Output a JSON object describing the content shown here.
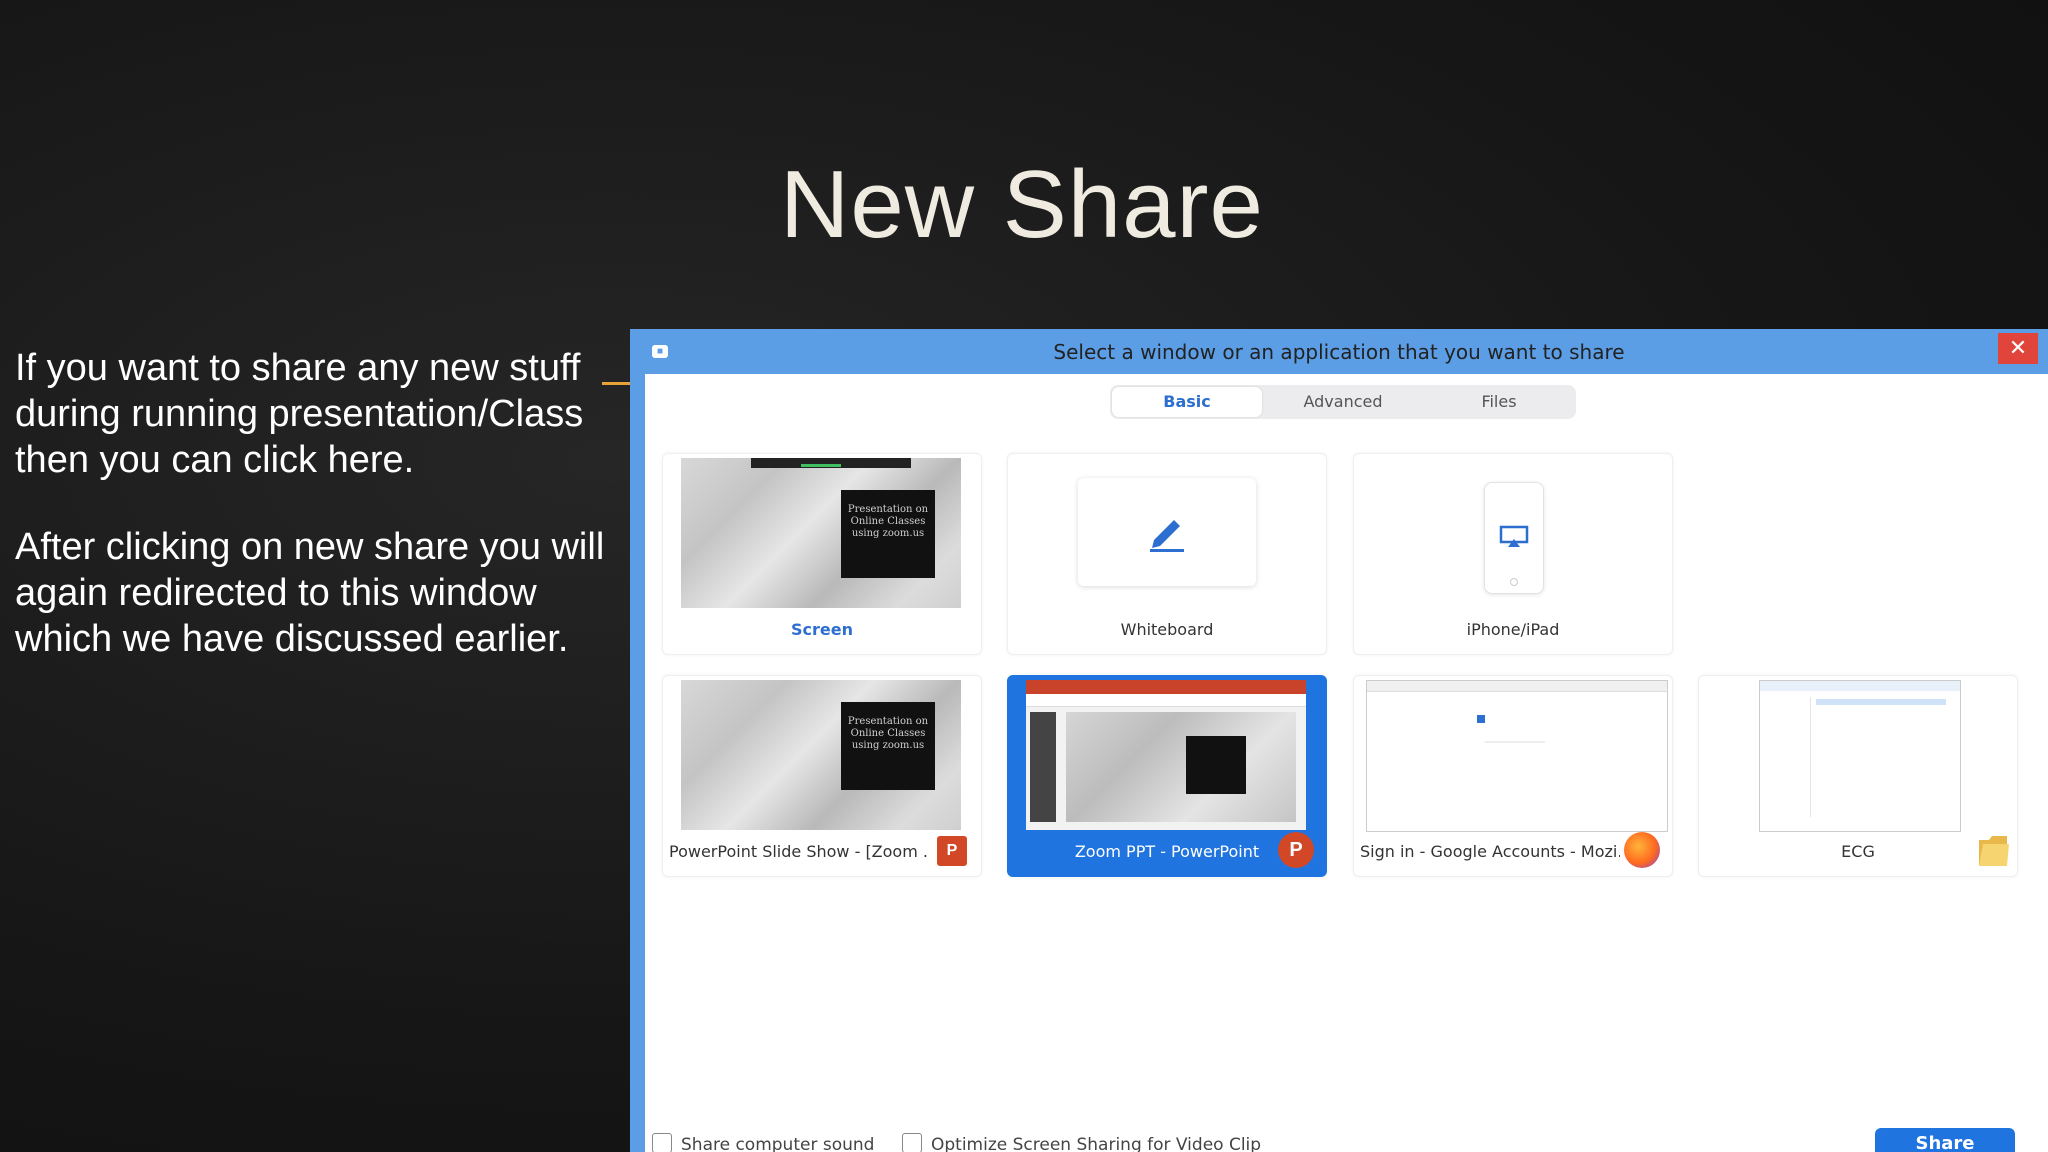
{
  "slide": {
    "title": "New Share",
    "paragraph1": "If you want to share any new stuff during running presentation/Class then you can click here.",
    "paragraph2": "After clicking on new share you will again redirected to this window which we have discussed earlier."
  },
  "dialog": {
    "title": "Select a window or an application that you want to share",
    "close_symbol": "✕",
    "tabs": [
      {
        "label": "Basic",
        "active": true
      },
      {
        "label": "Advanced",
        "active": false
      },
      {
        "label": "Files",
        "active": false
      }
    ],
    "tiles": [
      {
        "label": "Screen"
      },
      {
        "label": "Whiteboard"
      },
      {
        "label": "iPhone/iPad"
      },
      {
        "label": "PowerPoint Slide Show - [Zoom ..."
      },
      {
        "label": "Zoom PPT - PowerPoint"
      },
      {
        "label": "Sign in - Google Accounts - Mozi..."
      },
      {
        "label": "ECG"
      }
    ],
    "thumb_text": {
      "line1": "Presentation on",
      "line2": "Online Classes",
      "line3": "using zoom.us"
    },
    "footer": {
      "share_sound": "Share computer sound",
      "optimize": "Optimize Screen Sharing for Video Clip",
      "share_button": "Share"
    }
  },
  "colors": {
    "accent": "#1f74e0",
    "titlebar": "#5b9ee6",
    "close": "#e0443a",
    "pointer": "#e8a23a"
  }
}
